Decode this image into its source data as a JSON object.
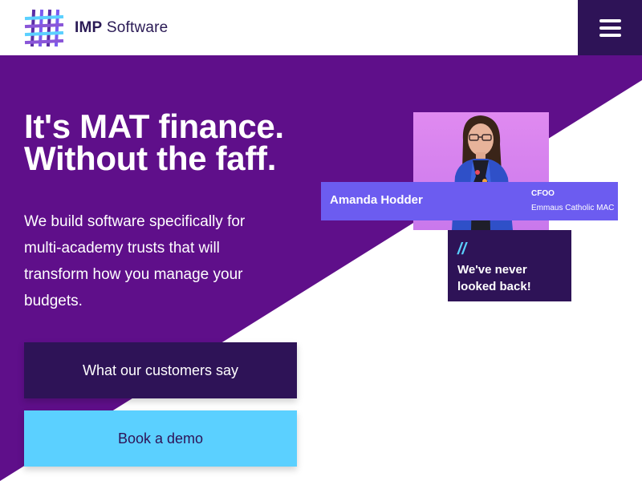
{
  "brand": {
    "name_bold": "IMP",
    "name_rest": " Software",
    "logo_icon": "hashtag-lattice-icon"
  },
  "header": {
    "menu_icon": "hamburger-menu-icon"
  },
  "hero": {
    "headline_line1": "It's MAT finance.",
    "headline_line2": "Without the faff.",
    "subtext": "We build software specifically for multi-academy trusts that will transform how you manage your budgets.",
    "cta_primary": "What our customers say",
    "cta_secondary": "Book a demo"
  },
  "testimonial": {
    "name": "Amanda Hodder",
    "role": "CFOO",
    "organisation": "Emmaus Catholic MAC",
    "quote_mark": "//",
    "quote": "We've never looked back!"
  },
  "colors": {
    "purple": "#5f0f8a",
    "dark_purple": "#2e1357",
    "light_blue": "#5bd0ff",
    "name_bar": "#6c5cf0"
  }
}
